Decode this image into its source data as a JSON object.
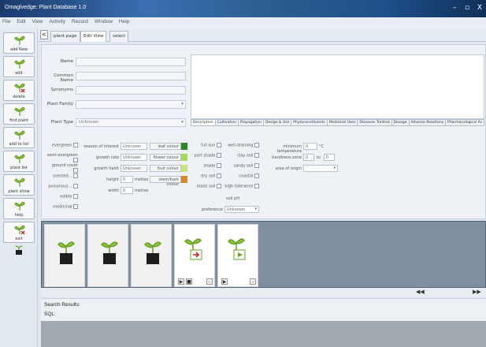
{
  "window": {
    "title": "Omaglvedge: Plant Database 1.0",
    "controls": {
      "minimize": "–",
      "maximize": "▫",
      "close": "X"
    }
  },
  "menu": [
    "File",
    "Edit",
    "View",
    "Activity",
    "Record",
    "Window",
    "Help"
  ],
  "toolbar": {
    "buttons": [
      "add New",
      "edit",
      "delete",
      "find plant",
      "add to list",
      "plant list",
      "plant show",
      "help",
      "exit"
    ]
  },
  "tabs": {
    "nav": "<",
    "items": [
      "plant page",
      "Edit View",
      "select"
    ]
  },
  "form": {
    "name_label": "Name",
    "common_name_label": "Common Name",
    "synonyms_label": "Synonyms",
    "plant_family_label": "Plant Family",
    "plant_type_label": "Plant Type",
    "plant_type_value": "Unknown"
  },
  "subtabs": [
    "Description",
    "Cultivation",
    "Propagation",
    "Design & Use",
    "Phytoconstituents",
    "Medicinal Uses",
    "Diseases Treated",
    "Dosage",
    "Adverse Reactions",
    "Pharmacological Ac"
  ],
  "attrs": {
    "col1": [
      "evergreen",
      "semi-evergreen",
      "ground cover",
      "scented...",
      "poisonous...",
      "edible",
      "medicinal"
    ],
    "col2_labels": [
      "season of interest",
      "growth rate",
      "growth habit",
      "height",
      "width"
    ],
    "col2_values": [
      "Unknown",
      "Unknown",
      "Unknown",
      "0",
      "0"
    ],
    "units": [
      "metres",
      "metres"
    ],
    "colors": [
      "leaf colour",
      "flower colour",
      "fruit colour",
      "stem/bark colour"
    ],
    "col3": [
      "full sun",
      "part shade",
      "shade",
      "dry soil",
      "moist soil"
    ],
    "col4": [
      "well-draining",
      "clay soil",
      "sandy soil",
      "coastal",
      "high tolerance"
    ],
    "soil_ph": "soil pH",
    "preference_label": "preference",
    "preference_value": "Unknown",
    "min_temp_label": "minimum temperature",
    "min_temp_value": "0",
    "min_temp_unit": "°C",
    "hardiness_label": "hardiness zone",
    "hardiness_from": "0",
    "hardiness_to_label": "to",
    "hardiness_to": "0",
    "origin_label": "area of origin"
  },
  "strip": {
    "nav_prev": "◀◀",
    "nav_next": "▶▶"
  },
  "search": {
    "results_label": "Search Results:",
    "sql_label": "SQL:"
  },
  "colors": {
    "accent": "#3a6fb2",
    "leaf": "#7ab32e"
  }
}
